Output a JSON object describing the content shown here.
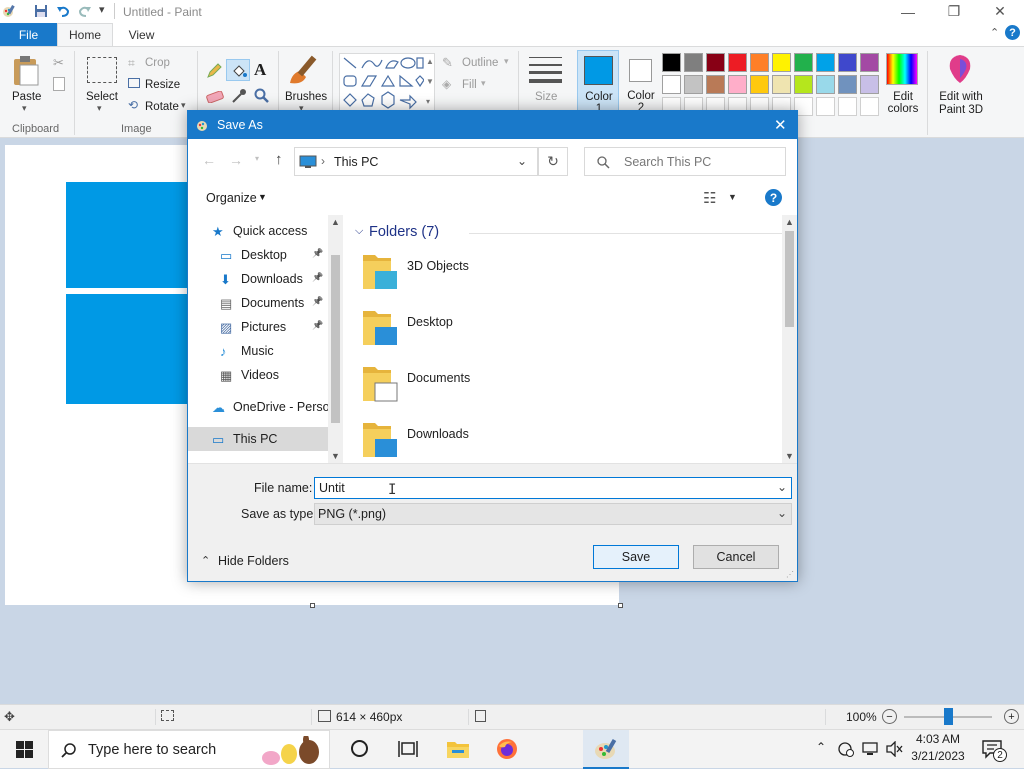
{
  "window": {
    "title": "Untitled - Paint",
    "minimize_glyph": "—",
    "maximize_glyph": "❐",
    "close_glyph": "✕"
  },
  "tabs": {
    "file": "File",
    "home": "Home",
    "view": "View"
  },
  "ribbon": {
    "clipboard": {
      "paste": "Paste",
      "group": "Clipboard"
    },
    "image": {
      "select": "Select",
      "crop": "Crop",
      "resize": "Resize",
      "rotate": "Rotate",
      "group": "Image"
    },
    "tools": {
      "brushes": "Brushes"
    },
    "shapes": {
      "outline": "Outline",
      "fill": "Fill"
    },
    "size": "Size",
    "color1": "Color 1",
    "color2": "Color 2",
    "edit_colors": "Edit colors",
    "edit_paint3d": "Edit with Paint 3D",
    "palette_row1": [
      "#000000",
      "#7f7f7f",
      "#880015",
      "#ed1c24",
      "#ff7f27",
      "#fff200",
      "#22b14c",
      "#00a2e8",
      "#3f48cc",
      "#a349a4"
    ],
    "palette_row2": [
      "#ffffff",
      "#c3c3c3",
      "#b97a57",
      "#ffaec9",
      "#ffc90e",
      "#efe4b0",
      "#b5e61d",
      "#99d9ea",
      "#7092be",
      "#c8bfe7"
    ],
    "color1_value": "#0099e5",
    "color2_value": "#ffffff"
  },
  "dialog": {
    "title": "Save As",
    "address": "This PC",
    "search_placeholder": "Search This PC",
    "organize": "Organize",
    "nav": [
      {
        "label": "Quick access",
        "icon": "star-icon"
      },
      {
        "label": "Desktop",
        "icon": "desktop-icon",
        "pinned": true
      },
      {
        "label": "Downloads",
        "icon": "download-icon",
        "pinned": true
      },
      {
        "label": "Documents",
        "icon": "document-icon",
        "pinned": true
      },
      {
        "label": "Pictures",
        "icon": "picture-icon",
        "pinned": true
      },
      {
        "label": "Music",
        "icon": "music-icon"
      },
      {
        "label": "Videos",
        "icon": "video-icon"
      },
      {
        "label": "OneDrive - Person",
        "icon": "cloud-icon"
      },
      {
        "label": "This PC",
        "icon": "computer-icon",
        "selected": true
      }
    ],
    "folders_header": "Folders (7)",
    "folders": [
      "3D Objects",
      "Desktop",
      "Documents",
      "Downloads"
    ],
    "file_name_label": "File name:",
    "file_name_value": "Untit",
    "save_as_type_label": "Save as type:",
    "save_as_type_value": "PNG (*.png)",
    "hide_folders": "Hide Folders",
    "save": "Save",
    "cancel": "Cancel"
  },
  "status": {
    "dimensions": "614 × 460px",
    "zoom": "100%",
    "zoom_level": 0.5
  },
  "taskbar": {
    "search_placeholder": "Type here to search",
    "time": "4:03 AM",
    "date": "3/21/2023",
    "notifications": "2"
  }
}
